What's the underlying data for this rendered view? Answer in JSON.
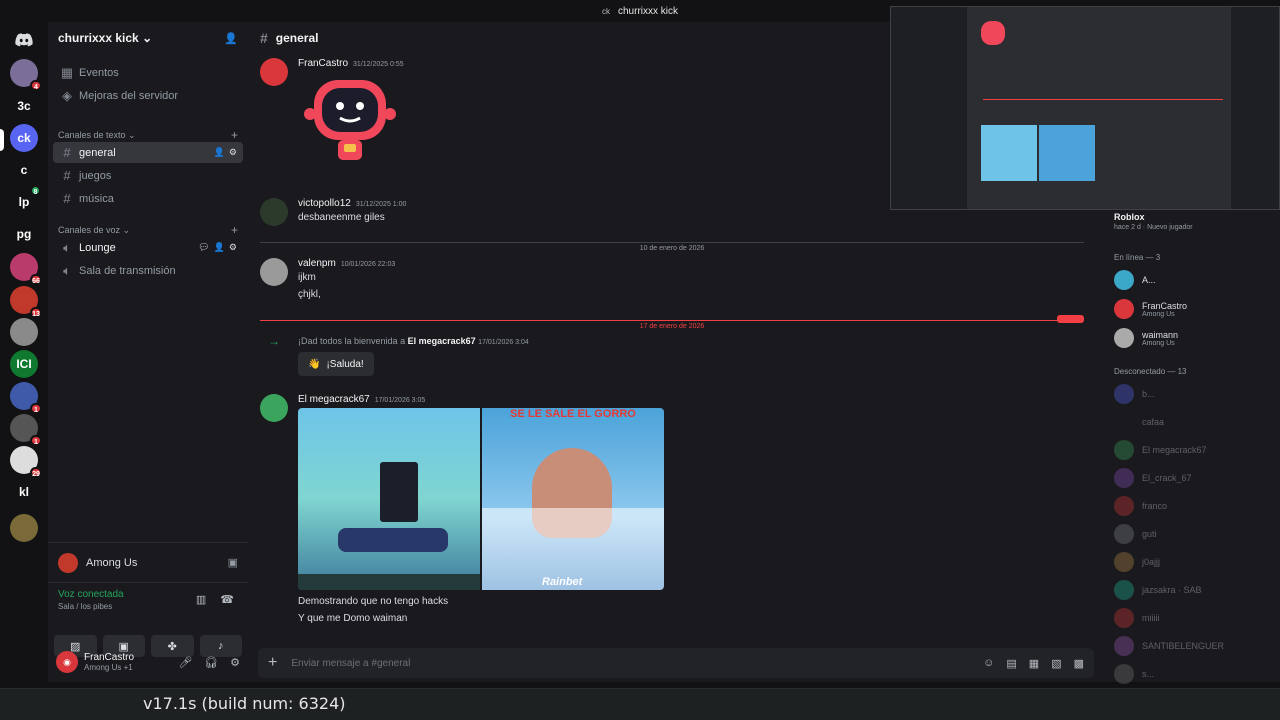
{
  "window": {
    "icon_label": "ck",
    "title": "churrixxx kick"
  },
  "servers": [
    {
      "label": "",
      "badge": "4",
      "color": "#7b6f9a"
    },
    {
      "label": "3c",
      "color": "#121214"
    },
    {
      "label": "ck",
      "color": "#5865f2"
    },
    {
      "label": "c",
      "color": "#121214"
    },
    {
      "label": "lp",
      "color": "#121214",
      "green": "8"
    },
    {
      "label": "pg",
      "color": "#121214"
    },
    {
      "label": "",
      "badge": "66",
      "color": "#b93b6b"
    },
    {
      "label": "",
      "badge": "13",
      "color": "#c0392b"
    },
    {
      "label": "",
      "color": "#8a8a8a"
    },
    {
      "label": "ICI",
      "color": "#0f7a2f"
    },
    {
      "label": "",
      "badge": "1",
      "color": "#3f5aa8"
    },
    {
      "label": "",
      "badge": "1",
      "color": "#555"
    },
    {
      "label": "",
      "badge": "29",
      "color": "#ddd"
    },
    {
      "label": "kl",
      "color": "#121214"
    },
    {
      "label": "",
      "color": "#7a6a3a"
    }
  ],
  "sidebar": {
    "guild": "churrixxx kick",
    "events": "Eventos",
    "boosts": "Mejoras del servidor",
    "text_cat": "Canales de texto",
    "text_channels": [
      "general",
      "juegos",
      "música"
    ],
    "voice_cat": "Canales de voz",
    "voice_channels": [
      "Lounge",
      "Sala de transmisión"
    ]
  },
  "activity": {
    "name": "Among Us"
  },
  "voice": {
    "status": "Voz conectada",
    "location": "Sala / los pibes"
  },
  "user": {
    "name": "FranCastro",
    "status": "Among Us +1"
  },
  "chat": {
    "channel": "general",
    "messages": [
      {
        "author": "FranCastro",
        "time": "31/12/2025 0:55"
      },
      {
        "author": "victopollo12",
        "time": "31/12/2025 1:00",
        "lines": [
          "desbaneenme giles"
        ]
      },
      {
        "author": "valenpm",
        "time": "10/01/2026 22:03",
        "lines": [
          "ijkm",
          "çhjkl,"
        ]
      },
      {
        "author": "El megacrack67",
        "time": "17/01/2026 3:05",
        "lines": [
          "Demostrando que no tengo hacks",
          "Y que me Domo waiman"
        ]
      }
    ],
    "divider1": "10 de enero de 2026",
    "divider2": "17 de enero de 2026",
    "new_label": "NUEVO",
    "welcome_pre": "¡Dad todos la bienvenida a",
    "welcome_user": "El megacrack67",
    "welcome_time": "17/01/2026 3:04",
    "saluda": "¡Saluda!",
    "img2_caption": "SE LE SALE EL GORRO",
    "img2_footer": "Rainbet",
    "composer_placeholder": "Enviar mensaje a #general"
  },
  "members": {
    "game_title": "Roblox",
    "game_sub": "hace 2 d · Nuevo jugador",
    "online_header": "En línea — 3",
    "online": [
      {
        "name": "A...",
        "status": "",
        "color": "#3ba7c9"
      },
      {
        "name": "FranCastro",
        "status": "Among Us",
        "color": "#da373c"
      },
      {
        "name": "waimann",
        "status": "Among Us",
        "color": "#aaaaaa"
      }
    ],
    "offline_header": "Desconectado — 13",
    "offline": [
      {
        "name": "b...",
        "color": "#5865f2"
      },
      {
        "name": "cafaa",
        "color": "#1a1a1e"
      },
      {
        "name": "El megacrack67",
        "color": "#3ba55d"
      },
      {
        "name": "El_crack_67",
        "color": "#8a4fbf"
      },
      {
        "name": "franco",
        "color": "#da373c"
      },
      {
        "name": "guti",
        "color": "#80848e"
      },
      {
        "name": "j0ajjj",
        "color": "#b98b4a"
      },
      {
        "name": "jazsakra · SAB",
        "color": "#1abc9c"
      },
      {
        "name": "miiiii",
        "color": "#da373c"
      },
      {
        "name": "SANTIBELENGUER",
        "color": "#9b59b6"
      },
      {
        "name": "s...",
        "color": "#777777"
      }
    ]
  },
  "build": "v17.1s (build num: 6324)"
}
